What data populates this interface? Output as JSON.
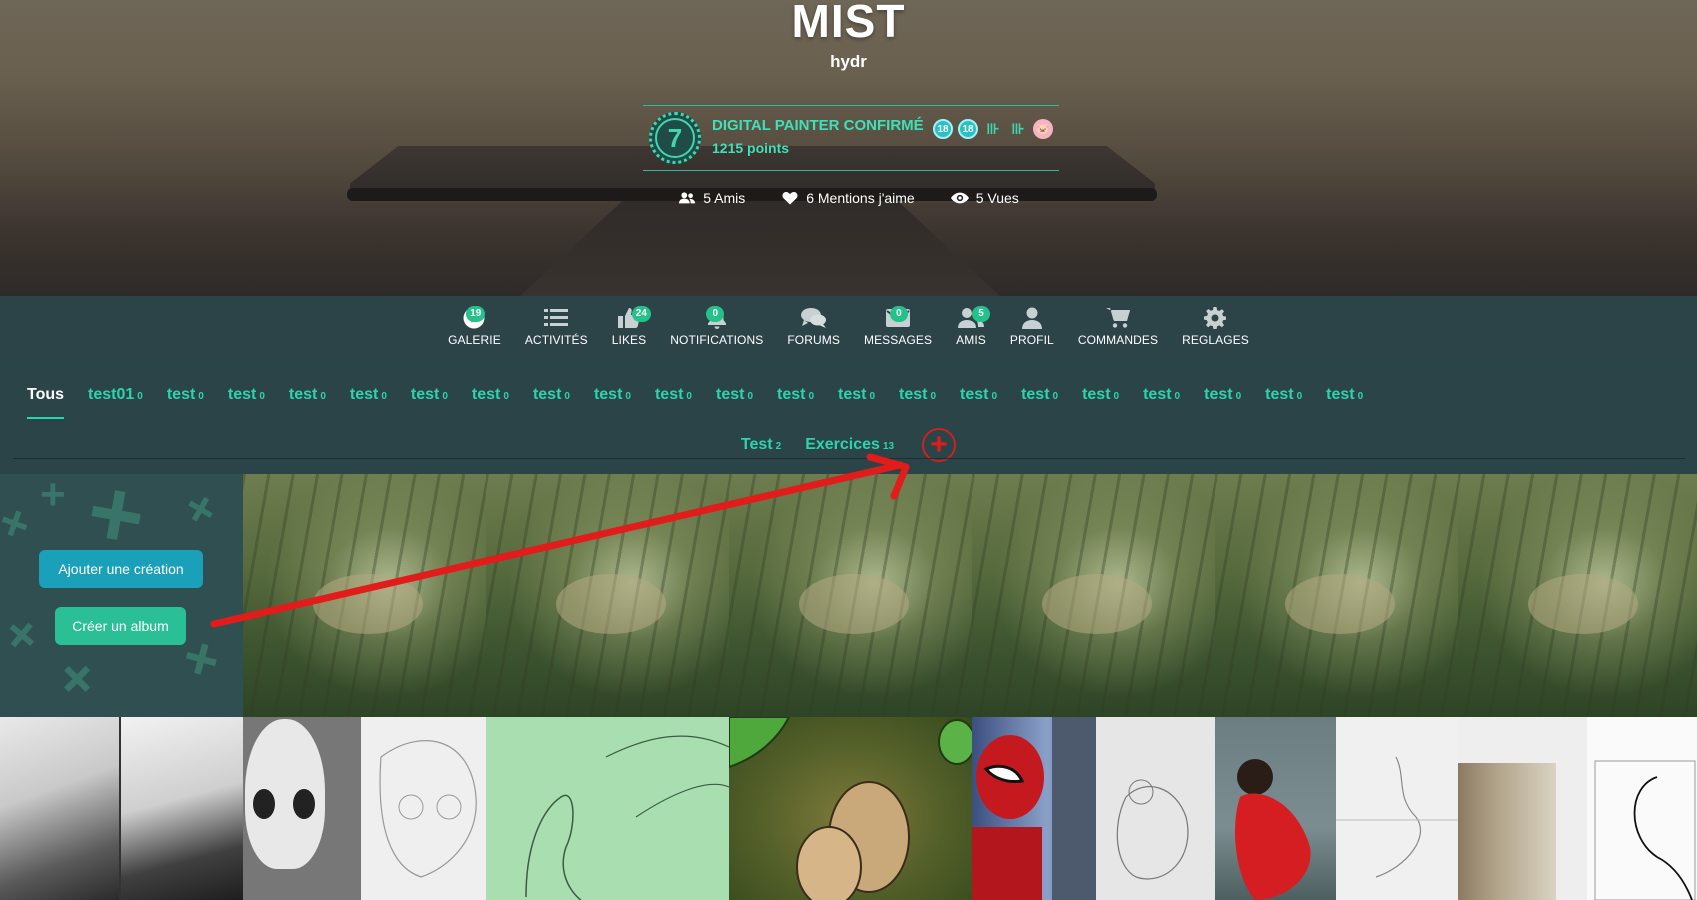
{
  "profile": {
    "name": "MIST",
    "username": "hydr",
    "level": "7",
    "rank_title": "DIGITAL PAINTER CONFIRMÉ",
    "points": "1215 points",
    "badges": [
      "badge-icon",
      "badge-icon",
      "trophy-icon",
      "trophy-icon",
      "pig-icon"
    ]
  },
  "stats": {
    "friends": "5 Amis",
    "likes": "6 Mentions j'aime",
    "views": "5 Vues"
  },
  "nav": {
    "items": [
      {
        "label": "GALERIE",
        "icon": "play-icon",
        "badge": "19"
      },
      {
        "label": "ACTIVITÉS",
        "icon": "list-icon",
        "badge": ""
      },
      {
        "label": "LIKES",
        "icon": "thumbs-up-icon",
        "badge": "24"
      },
      {
        "label": "NOTIFICATIONS",
        "icon": "bell-icon",
        "badge": "0"
      },
      {
        "label": "FORUMS",
        "icon": "chat-icon",
        "badge": ""
      },
      {
        "label": "MESSAGES",
        "icon": "envelope-icon",
        "badge": "0"
      },
      {
        "label": "AMIS",
        "icon": "users-icon",
        "badge": "5"
      },
      {
        "label": "PROFIL",
        "icon": "user-icon",
        "badge": ""
      },
      {
        "label": "COMMANDES",
        "icon": "cart-icon",
        "badge": ""
      },
      {
        "label": "REGLAGES",
        "icon": "gear-icon",
        "badge": ""
      }
    ]
  },
  "albums": {
    "row1": [
      {
        "label": "Tous",
        "count": ""
      },
      {
        "label": "test01",
        "count": "0"
      },
      {
        "label": "test",
        "count": "0"
      },
      {
        "label": "test",
        "count": "0"
      },
      {
        "label": "test",
        "count": "0"
      },
      {
        "label": "test",
        "count": "0"
      },
      {
        "label": "test",
        "count": "0"
      },
      {
        "label": "test",
        "count": "0"
      },
      {
        "label": "test",
        "count": "0"
      },
      {
        "label": "test",
        "count": "0"
      },
      {
        "label": "test",
        "count": "0"
      },
      {
        "label": "test",
        "count": "0"
      },
      {
        "label": "test",
        "count": "0"
      },
      {
        "label": "test",
        "count": "0"
      },
      {
        "label": "test",
        "count": "0"
      },
      {
        "label": "test",
        "count": "0"
      },
      {
        "label": "test",
        "count": "0"
      },
      {
        "label": "test",
        "count": "0"
      },
      {
        "label": "test",
        "count": "0"
      },
      {
        "label": "test",
        "count": "0"
      },
      {
        "label": "test",
        "count": "0"
      },
      {
        "label": "test",
        "count": "0"
      }
    ],
    "row2": [
      {
        "label": "Test",
        "count": "2"
      },
      {
        "label": "Exercices",
        "count": "13"
      }
    ],
    "add_label": "+"
  },
  "actions": {
    "add_creation": "Ajouter une création",
    "create_album": "Créer un album"
  },
  "colors": {
    "accent": "#2bd4ad",
    "nav_bg": "#2c4448",
    "badge": "#25c18a",
    "annotation_arrow": "#e21b1b"
  }
}
